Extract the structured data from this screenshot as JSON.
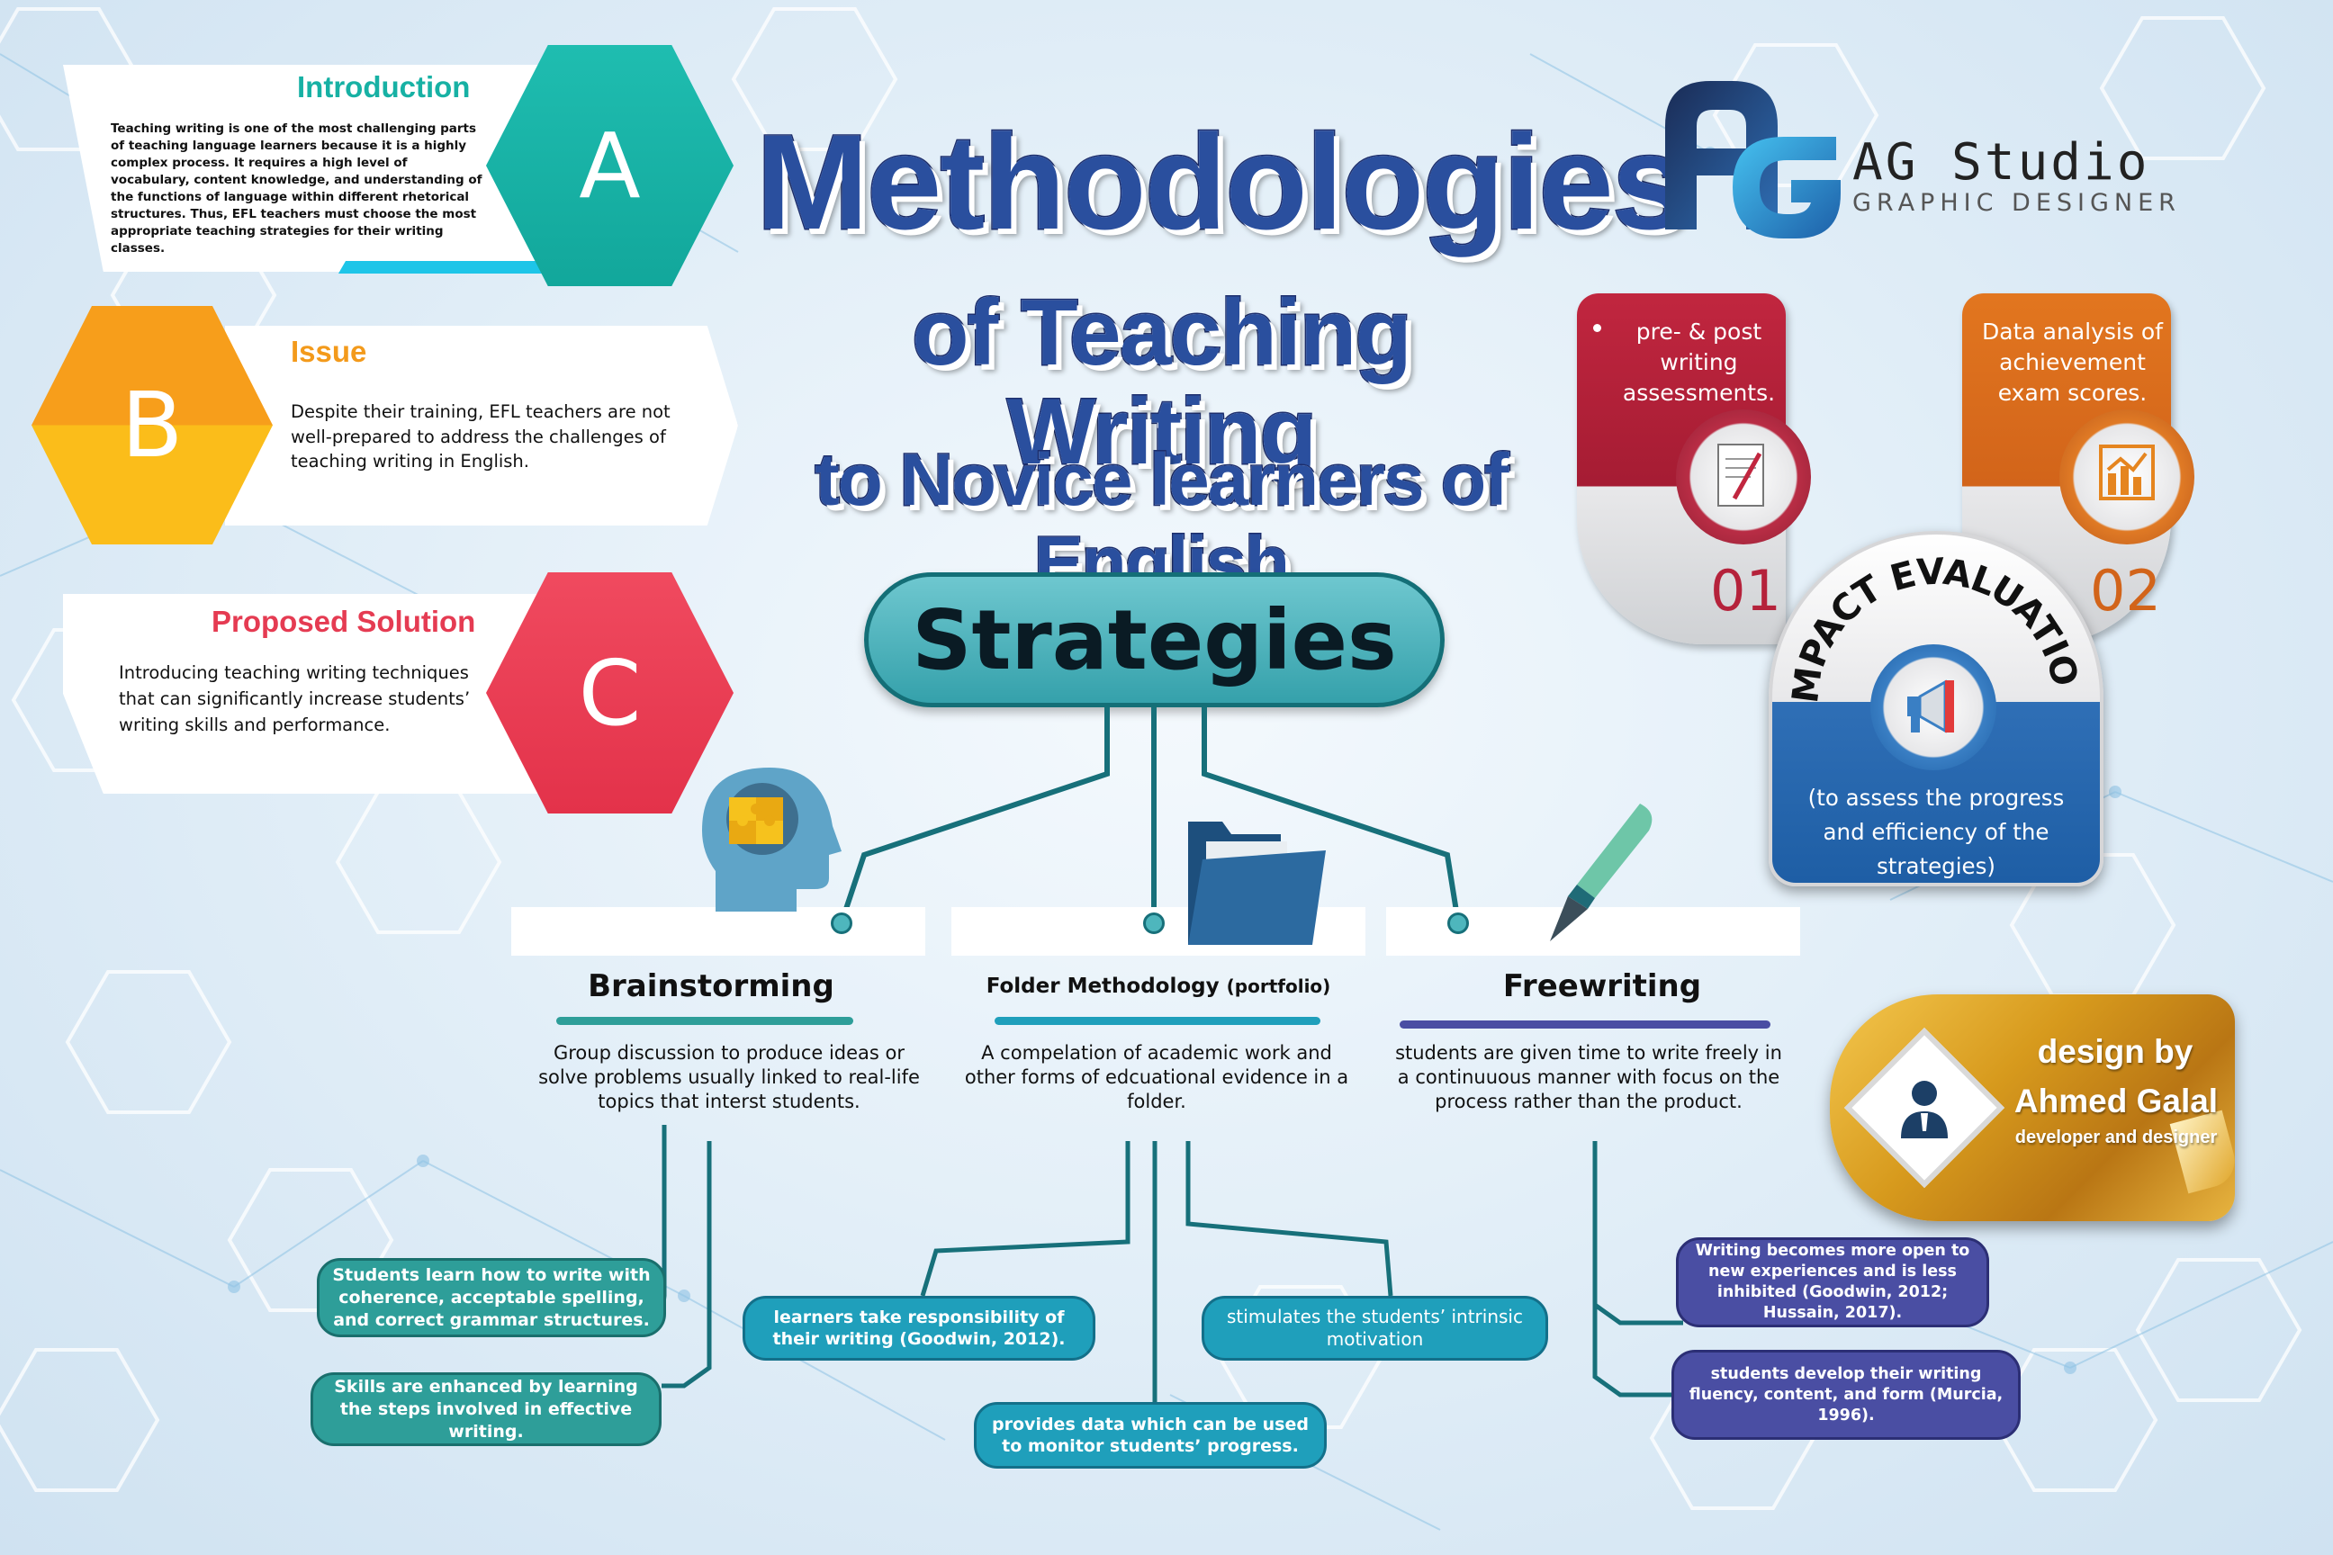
{
  "title": {
    "line1": "Methodologies",
    "line2": "of Teaching Writing",
    "line3": "to Novice learners of English"
  },
  "brand": {
    "name": "AG Studio",
    "subtitle": "GRAPHIC DESIGNER"
  },
  "sections": [
    {
      "letter": "A",
      "title": "Introduction",
      "text": "Teaching writing is one of the most challenging parts of teaching language learners because it is a highly complex process. It requires a high level of vocabulary, content knowledge, and understanding of the functions of language within different rhetorical structures. Thus, EFL teachers must choose the most appropriate teaching strategies for their writing classes.",
      "color": "#17b1a4"
    },
    {
      "letter": "B",
      "title": "Issue",
      "text": "Despite their training, EFL teachers are not well-prepared to address the challenges of teaching writing in English.",
      "color": "#f7a81b"
    },
    {
      "letter": "C",
      "title": "Proposed Solution",
      "text": "Introducing teaching writing techniques that can significantly increase students’ writing skills and performance.",
      "color": "#ee4056"
    }
  ],
  "strategies": {
    "label": "Strategies",
    "items": [
      {
        "title": "Brainstorming",
        "title_suffix": "",
        "description": "Group discussion to produce ideas or solve problems usually linked to real-life topics that interst students.",
        "accent": "#2e9e99",
        "notes": [
          "Students learn how to write with coherence, acceptable spelling, and correct grammar structures.",
          "Skills are enhanced by learning the steps involved in effective writing."
        ]
      },
      {
        "title": "Folder Methodology",
        "title_suffix": "(portfolio)",
        "description": "A compelation of academic work and other forms of edcuational evidence in a folder.",
        "accent": "#1f9fbb",
        "notes": [
          "learners take responsibility of their writing (Goodwin, 2012).",
          "provides data which can be used to monitor students’ progress.",
          "stimulates the students’ intrinsic motivation"
        ]
      },
      {
        "title": "Freewriting",
        "title_suffix": "",
        "description": "students are given time to write freely in a continuuous manner with focus on the process rather than the product.",
        "accent": "#4a4ea3",
        "notes": [
          "Writing becomes more open to new experiences and is less inhibited (Goodwin, 2012; Hussain, 2017).",
          "students develop their writing fluency, content, and form (Murcia, 1996)."
        ]
      }
    ]
  },
  "impact": {
    "heading": "IMPACT EVALUATION",
    "description": "(to assess the progress and efficiency of the strategies)",
    "items": [
      {
        "number": "01",
        "text": "pre- & post writing assessments.",
        "color": "#b5223b",
        "icon": "document-icon"
      },
      {
        "number": "02",
        "text": "Data analysis of achievement exam scores.",
        "color": "#dd6e1f",
        "icon": "bar-chart-icon"
      }
    ]
  },
  "credit": {
    "label": "design by",
    "name": "Ahmed Galal",
    "role": "developer and designer"
  }
}
